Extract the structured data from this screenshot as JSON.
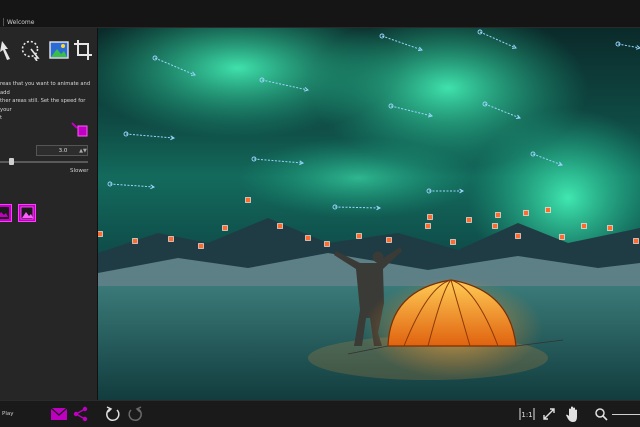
{
  "tabbar": {
    "tab_label": "Welcome"
  },
  "tools": [
    {
      "name": "pin-arrow-icon"
    },
    {
      "name": "lasso-select-icon"
    },
    {
      "name": "image-icon"
    },
    {
      "name": "crop-icon"
    }
  ],
  "sidebar": {
    "instructions": "reas that you want to animate and add\nther areas still. Set the speed for your\nt",
    "speed_value": "3.0",
    "speed_spin": "▲▼",
    "slower_label": "Slower"
  },
  "bottombar": {
    "play_label": "Play",
    "zoom_fit_label": "1:1"
  },
  "colors": {
    "accent": "#c000c0",
    "arrow": "#9ad6ff",
    "anchor": "#ff6a2f"
  }
}
